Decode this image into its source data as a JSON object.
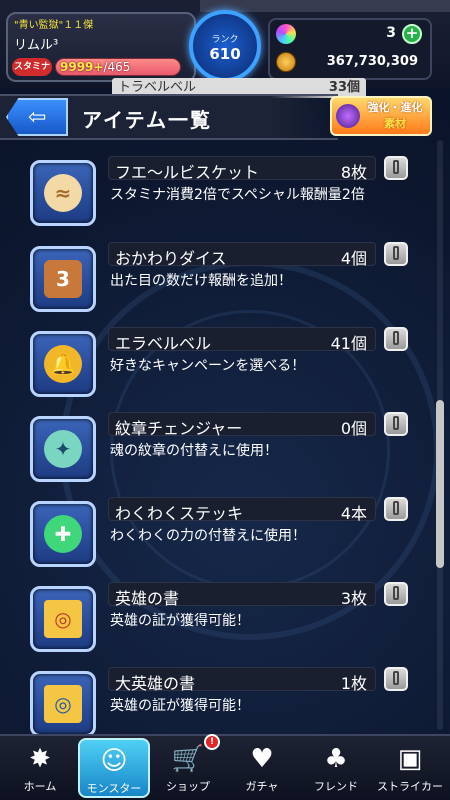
{
  "player": {
    "title": "\"青い監獄\"１１傑",
    "name": "リムル³",
    "stamina_tag": "スタミナ",
    "stamina_current": "9999+",
    "stamina_max": "/465",
    "rank_label": "ランク",
    "rank": "610"
  },
  "currency": {
    "gems": "3",
    "coins": "367,730,309"
  },
  "ghost_row": {
    "name": "トラベルベル",
    "count": "33個"
  },
  "page": {
    "title": "アイテム一覧",
    "evolve_line1": "強化・進化",
    "evolve_line2": "素材"
  },
  "items": [
    {
      "name": "フエ〜ルビスケット",
      "count": "8枚",
      "desc": "スタミナ消費2倍でスペシャル報酬量2倍",
      "icon": "biscuit-icon"
    },
    {
      "name": "おかわりダイス",
      "count": "4個",
      "desc": "出た目の数だけ報酬を追加！",
      "icon": "dice-icon"
    },
    {
      "name": "エラベルベル",
      "count": "41個",
      "desc": "好きなキャンペーンを選べる！",
      "icon": "bell-icon"
    },
    {
      "name": "紋章チェンジャー",
      "count": "0個",
      "desc": "魂の紋章の付替えに使用！",
      "icon": "emblem-changer-icon"
    },
    {
      "name": "わくわくステッキ",
      "count": "4本",
      "desc": "わくわくの力の付替えに使用！",
      "icon": "magic-stick-icon"
    },
    {
      "name": "英雄の書",
      "count": "3枚",
      "desc": "英雄の証が獲得可能！",
      "icon": "scroll-icon"
    },
    {
      "name": "大英雄の書",
      "count": "1枚",
      "desc": "英雄の証が獲得可能！",
      "icon": "great-scroll-icon"
    }
  ],
  "nav": [
    {
      "label": "ホーム",
      "icon": "home-icon"
    },
    {
      "label": "モンスター",
      "icon": "monster-icon"
    },
    {
      "label": "ショップ",
      "icon": "shop-icon"
    },
    {
      "label": "ガチャ",
      "icon": "gacha-icon"
    },
    {
      "label": "フレンド",
      "icon": "friend-icon"
    },
    {
      "label": "ストライカー",
      "icon": "striker-icon"
    }
  ],
  "shop_badge": "!"
}
